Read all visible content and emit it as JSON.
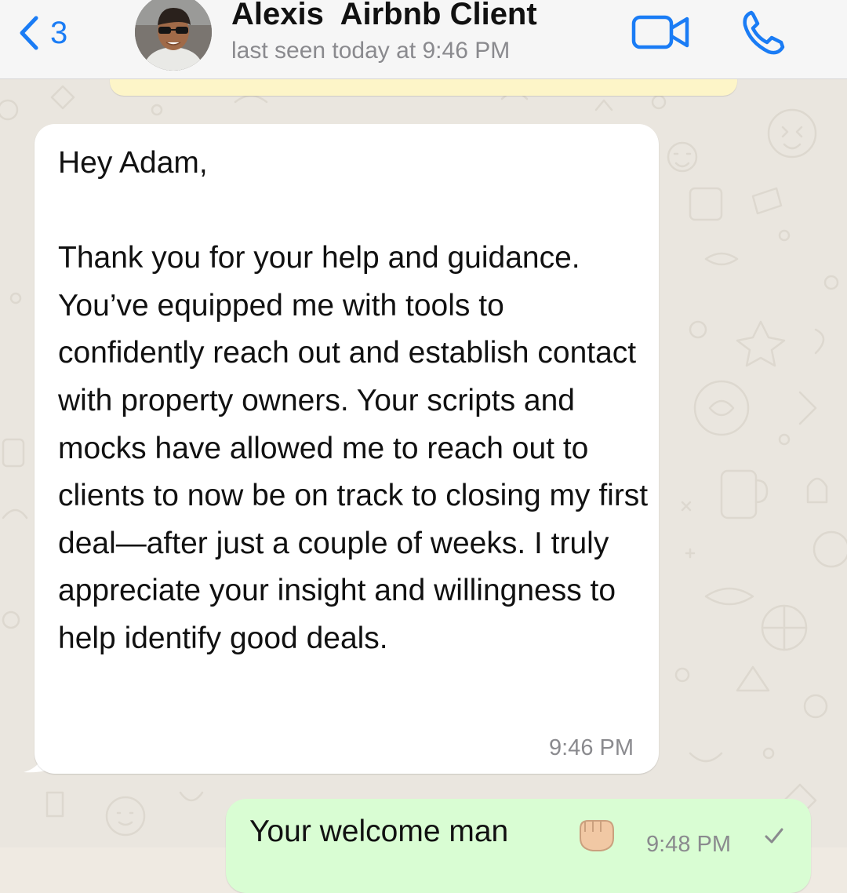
{
  "header": {
    "back_count": "3",
    "contact_name": "Alexis  Airbnb Client",
    "status": "last seen today at 9:46 PM",
    "icons": {
      "back": "chevron-left-icon",
      "video": "video-camera-icon",
      "call": "phone-icon"
    },
    "accent_color": "#1a7cf5"
  },
  "messages": [
    {
      "direction": "incoming",
      "text": "Hey Adam,\n\nThank you for your help and guidance. You’ve equipped me with tools to confidently reach out and establish contact with property owners. Your scripts and mocks have allowed me to reach out to clients to now be on track to closing my first deal—after just a couple of weeks. I truly appreciate your insight and willingness to help identify good deals.",
      "time": "9:46 PM",
      "bubble_color": "#ffffff"
    },
    {
      "direction": "outgoing",
      "text": "Your welcome man",
      "emoji": "fist-emoji",
      "time": "9:48 PM",
      "status_icon": "sent-check-icon",
      "bubble_color": "#d9fdd3"
    }
  ],
  "colors": {
    "chat_background": "#eae6df",
    "previous_bubble": "#fdf5c8"
  }
}
